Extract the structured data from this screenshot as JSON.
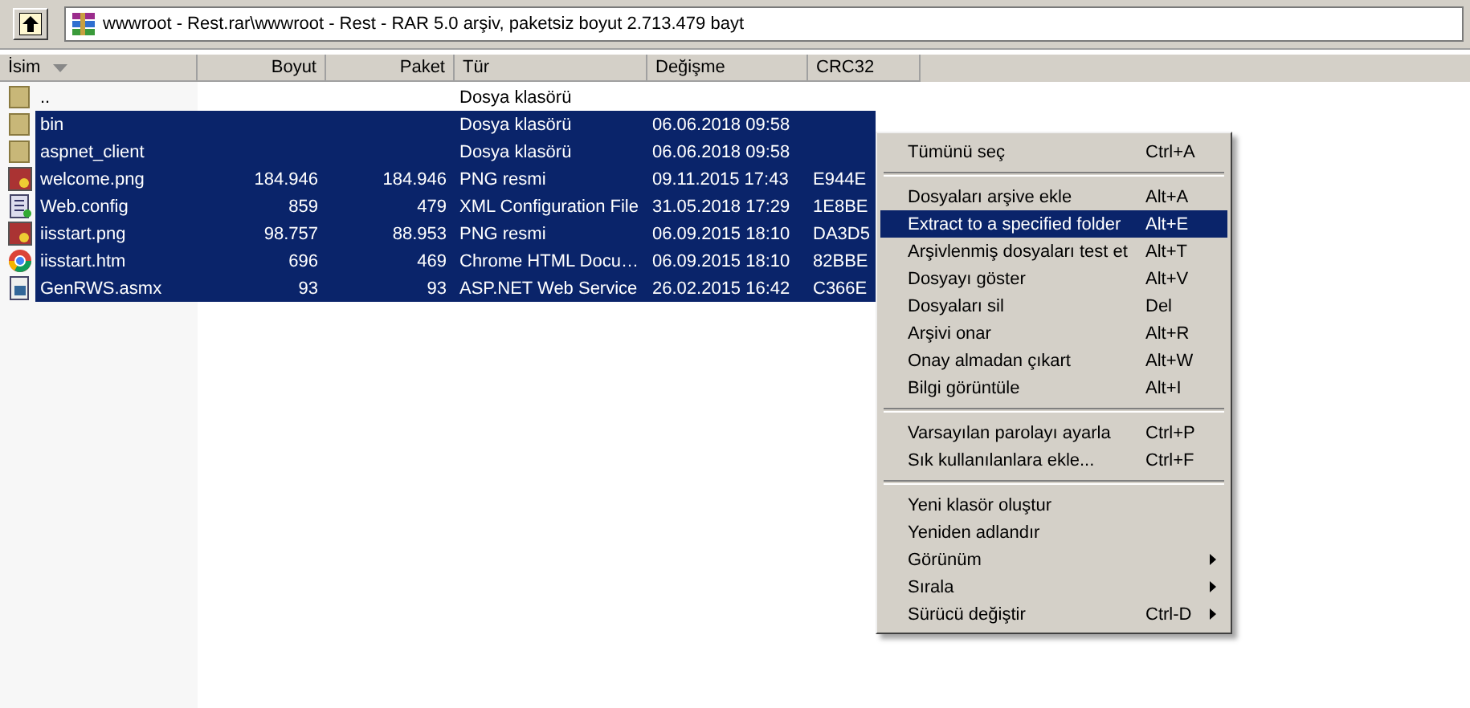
{
  "address": {
    "text": "wwwroot - Rest.rar\\wwwroot - Rest - RAR 5.0 arşiv, paketsiz boyut 2.713.479 bayt"
  },
  "columns": [
    {
      "label": "İsim",
      "sorted": true
    },
    {
      "label": "Boyut",
      "sorted": false
    },
    {
      "label": "Paket",
      "sorted": false
    },
    {
      "label": "Tür",
      "sorted": false
    },
    {
      "label": "Değişme",
      "sorted": false
    },
    {
      "label": "CRC32",
      "sorted": false
    }
  ],
  "rows": [
    {
      "kind": "folder",
      "name": "..",
      "type": "Dosya klasörü",
      "selected": false
    },
    {
      "kind": "folder",
      "name": "bin",
      "type": "Dosya klasörü",
      "modified": "06.06.2018 09:58",
      "selected": true
    },
    {
      "kind": "folder",
      "name": "aspnet_client",
      "type": "Dosya klasörü",
      "modified": "06.06.2018 09:58",
      "selected": true
    },
    {
      "kind": "image",
      "name": "welcome.png",
      "size": "184.946",
      "packed": "184.946",
      "type": "PNG resmi",
      "modified": "09.11.2015 17:43",
      "crc": "E944E",
      "selected": true
    },
    {
      "kind": "config",
      "name": "Web.config",
      "size": "859",
      "packed": "479",
      "type": "XML Configuration File",
      "modified": "31.05.2018 17:29",
      "crc": "1E8BE",
      "selected": true
    },
    {
      "kind": "image",
      "name": "iisstart.png",
      "size": "98.757",
      "packed": "88.953",
      "type": "PNG resmi",
      "modified": "06.09.2015 18:10",
      "crc": "DA3D5",
      "selected": true
    },
    {
      "kind": "browser",
      "name": "iisstart.htm",
      "size": "696",
      "packed": "469",
      "type": "Chrome HTML Docu…",
      "modified": "06.09.2015 18:10",
      "crc": "82BBE",
      "selected": true
    },
    {
      "kind": "service",
      "name": "GenRWS.asmx",
      "size": "93",
      "packed": "93",
      "type": "ASP.NET Web Service",
      "modified": "26.02.2015 16:42",
      "crc": "C366E",
      "selected": true
    }
  ],
  "context_menu": [
    {
      "kind": "item",
      "label": "Tümünü seç",
      "shortcut": "Ctrl+A",
      "submenu": false,
      "selected": false
    },
    {
      "kind": "separator"
    },
    {
      "kind": "item",
      "label": "Dosyaları arşive ekle",
      "shortcut": "Alt+A",
      "submenu": false,
      "selected": false
    },
    {
      "kind": "item",
      "label": "Extract to a specified folder",
      "shortcut": "Alt+E",
      "submenu": false,
      "selected": true
    },
    {
      "kind": "item",
      "label": "Arşivlenmiş dosyaları test et",
      "shortcut": "Alt+T",
      "submenu": false,
      "selected": false
    },
    {
      "kind": "item",
      "label": "Dosyayı göster",
      "shortcut": "Alt+V",
      "submenu": false,
      "selected": false
    },
    {
      "kind": "item",
      "label": "Dosyaları sil",
      "shortcut": "Del",
      "submenu": false,
      "selected": false
    },
    {
      "kind": "item",
      "label": "Arşivi onar",
      "shortcut": "Alt+R",
      "submenu": false,
      "selected": false
    },
    {
      "kind": "item",
      "label": "Onay almadan çıkart",
      "shortcut": "Alt+W",
      "submenu": false,
      "selected": false
    },
    {
      "kind": "item",
      "label": "Bilgi görüntüle",
      "shortcut": "Alt+I",
      "submenu": false,
      "selected": false
    },
    {
      "kind": "separator"
    },
    {
      "kind": "item",
      "label": "Varsayılan parolayı ayarla",
      "shortcut": "Ctrl+P",
      "submenu": false,
      "selected": false
    },
    {
      "kind": "item",
      "label": "Sık kullanılanlara ekle...",
      "shortcut": "Ctrl+F",
      "submenu": false,
      "selected": false
    },
    {
      "kind": "separator"
    },
    {
      "kind": "item",
      "label": "Yeni klasör oluştur",
      "submenu": false,
      "selected": false
    },
    {
      "kind": "item",
      "label": "Yeniden adlandır",
      "submenu": false,
      "selected": false
    },
    {
      "kind": "item",
      "label": "Görünüm",
      "submenu": true,
      "selected": false
    },
    {
      "kind": "item",
      "label": "Sırala",
      "submenu": true,
      "selected": false
    },
    {
      "kind": "item",
      "label": "Sürücü değiştir",
      "shortcut": "Ctrl-D",
      "submenu": true,
      "selected": false
    }
  ]
}
